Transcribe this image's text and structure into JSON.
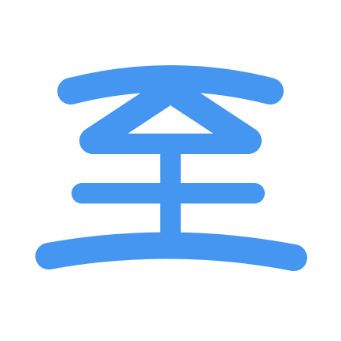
{
  "logo": {
    "icon": "zhi-character-logo-icon",
    "glyph": "至",
    "color": "#4596f0",
    "background": "#ffffff"
  }
}
